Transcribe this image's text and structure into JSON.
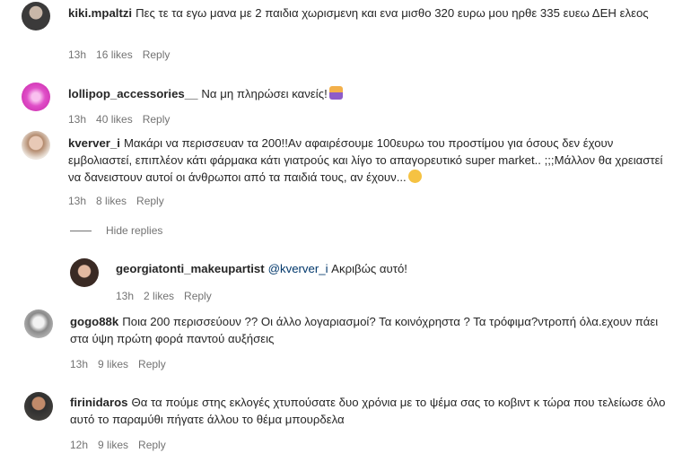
{
  "comments": [
    {
      "username": "kiki.mpaltzi",
      "text": "Πες τε τα εγω μανα με 2 παιδια χωρισμενη και ενα μισθο 320 ευρω μου ηρθε 335 ευεω ΔΕΗ ελεος",
      "time": "13h",
      "likes": "16 likes",
      "reply": "Reply"
    },
    {
      "username": "lollipop_accessories__",
      "text": "Να μη πληρώσει κανείς!",
      "time": "13h",
      "likes": "40 likes",
      "reply": "Reply"
    },
    {
      "username": "kverver_i",
      "text": "Μακάρι να περισσευαν τα 200!!Αν αφαιρέσουμε 100ευρω του προστίμου για όσους δεν έχουν εμβολιαστεί, επιπλέον κάτι φάρμακα κάτι γιατρούς και λίγο το απαγορευτικό super market.. ;;;Μάλλον θα χρειαστεί να δανειστουν αυτοί οι άνθρωποι από τα παιδιά τους, αν έχουν...",
      "time": "13h",
      "likes": "8 likes",
      "reply": "Reply",
      "hide_replies": "Hide replies"
    },
    {
      "username": "georgiatonti_makeupartist",
      "mention": "@kverver_i",
      "text": " Ακριβώς αυτό!",
      "time": "13h",
      "likes": "2 likes",
      "reply": "Reply"
    },
    {
      "username": "gogo88k",
      "text": "Ποια 200 περισσεύουν ?? Οι άλλο λογαριασμοί? Τα κοινόχρηστα ? Τα τρόφιμα?ντροπή όλα.εχουν πάει στα ύψη πρώτη φορά παντού αυξήσεις",
      "time": "13h",
      "likes": "9 likes",
      "reply": "Reply"
    },
    {
      "username": "firinidaros",
      "text": "Θα τα πούμε στης εκλογές χτυπούσατε δυο χρόνια με το ψέμα σας το κοβιντ κ τώρα που τελείωσε όλο αυτό το παραμύθι πήγατε άλλου το θέμα μπουρδελα",
      "time": "12h",
      "likes": "9 likes",
      "reply": "Reply"
    }
  ],
  "colors": {
    "text": "#262626",
    "meta": "#737373",
    "mention": "#00376b"
  }
}
